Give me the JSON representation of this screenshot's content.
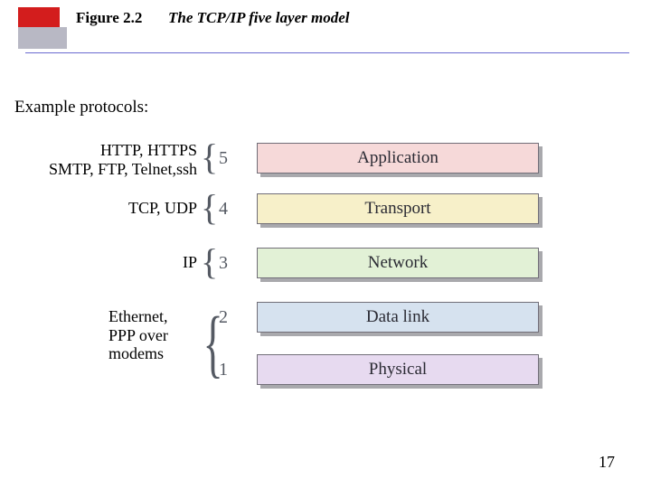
{
  "figure_number": "Figure 2.2",
  "figure_title": "The TCP/IP five layer model",
  "subtitle": "Example protocols:",
  "page_number": "17",
  "layers": {
    "l5": {
      "num": "5",
      "name": "Application",
      "proto_line1": "HTTP, HTTPS",
      "proto_line2": "SMTP, FTP, Telnet,ssh"
    },
    "l4": {
      "num": "4",
      "name": "Transport",
      "proto": "TCP, UDP"
    },
    "l3": {
      "num": "3",
      "name": "Network",
      "proto": "IP"
    },
    "l2": {
      "num": "2",
      "name": "Data link"
    },
    "l1": {
      "num": "1",
      "name": "Physical"
    },
    "phys_proto_line1": "Ethernet,",
    "phys_proto_line2": "PPP over",
    "phys_proto_line3": "modems"
  }
}
